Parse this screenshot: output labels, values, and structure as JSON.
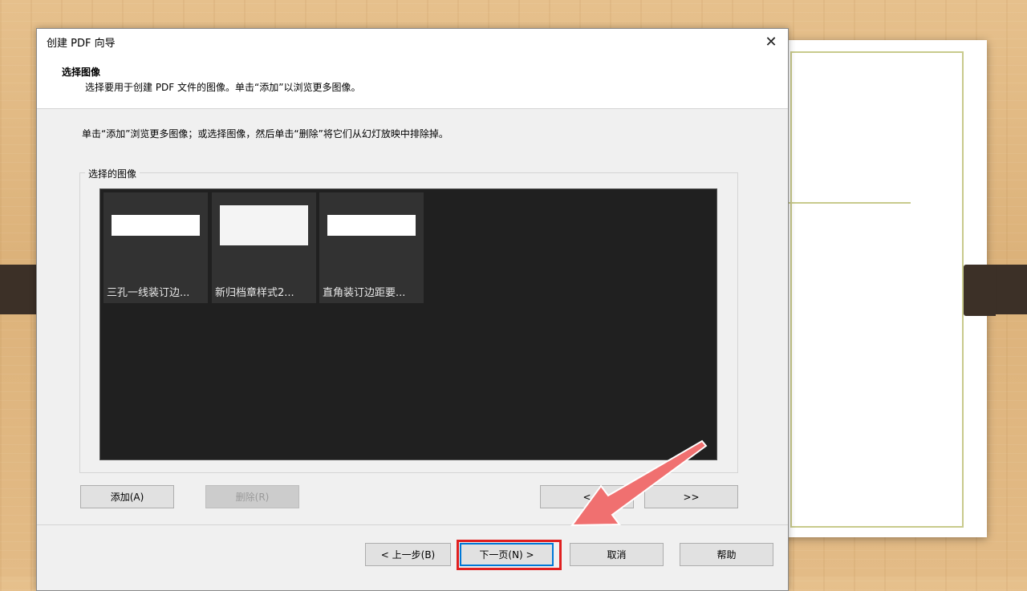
{
  "dialog": {
    "title": "创建 PDF 向导",
    "close_glyph": "✕",
    "header_title": "选择图像",
    "header_subtitle": "选择要用于创建 PDF 文件的图像。单击“添加”以浏览更多图像。",
    "instruction": "单击“添加”浏览更多图像；或选择图像，然后单击“删除”将它们从幻灯放映中排除掉。",
    "group_label": "选择的图像",
    "thumbnails": [
      {
        "label": "三孔一线装订边..."
      },
      {
        "label": "新归档章样式2..."
      },
      {
        "label": "直角装订边距要..."
      }
    ],
    "buttons": {
      "add": "添加(A)",
      "delete": "删除(R)",
      "prev_image": "<",
      "next_image": ">>",
      "back": "< 上一步(B)",
      "next": "下一页(N) >",
      "cancel": "取消",
      "help": "帮助"
    }
  },
  "colors": {
    "highlight": "#e02020",
    "arrow": "#f07070"
  }
}
